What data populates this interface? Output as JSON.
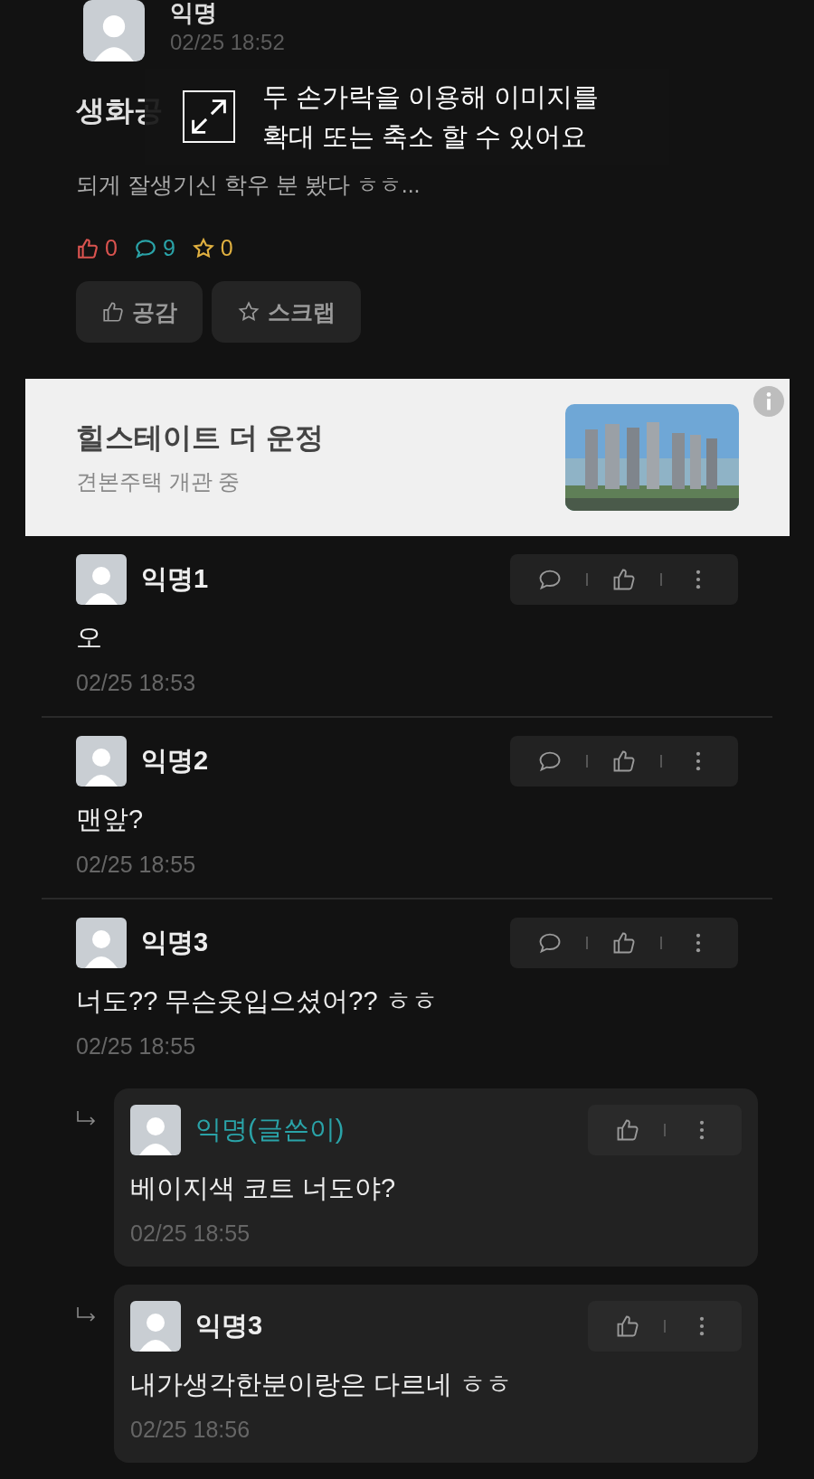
{
  "post": {
    "author": "익명",
    "time": "02/25 18:52",
    "title": "생화공",
    "body": "되게 잘생기신 학우 분 봤다 ㅎㅎ...",
    "counts": [
      {
        "kind": "like",
        "count": "0",
        "color": "#d9534f"
      },
      {
        "kind": "comment",
        "count": "9",
        "color": "#2aa3a8"
      },
      {
        "kind": "scrap",
        "count": "0",
        "color": "#e0b040"
      }
    ],
    "buttons": [
      {
        "kind": "like",
        "label": "공감"
      },
      {
        "kind": "scrap",
        "label": "스크랩"
      }
    ]
  },
  "tooltip": {
    "lines": [
      "두 손가락을 이용해 이미지를",
      "확대 또는 축소 할 수 있어요"
    ]
  },
  "ad": {
    "title": "힐스테이트 더 운정",
    "subtitle": "견본주택 개관 중"
  },
  "comments": [
    {
      "kind": "comment",
      "name": "익명1",
      "writer": false,
      "text": "오",
      "time": "02/25 18:53"
    },
    {
      "kind": "comment",
      "name": "익명2",
      "writer": false,
      "text": "맨앞?",
      "time": "02/25 18:55"
    },
    {
      "kind": "comment",
      "name": "익명3",
      "writer": false,
      "text": "너도?? 무슨옷입으셨어?? ㅎㅎ",
      "time": "02/25 18:55"
    },
    {
      "kind": "reply",
      "name": "익명(글쓴이)",
      "writer": true,
      "text": "베이지색 코트 너도야?",
      "time": "02/25 18:55"
    },
    {
      "kind": "reply",
      "name": "익명3",
      "writer": false,
      "text": "내가생각한분이랑은 다르네 ㅎㅎ",
      "time": "02/25 18:56"
    }
  ]
}
